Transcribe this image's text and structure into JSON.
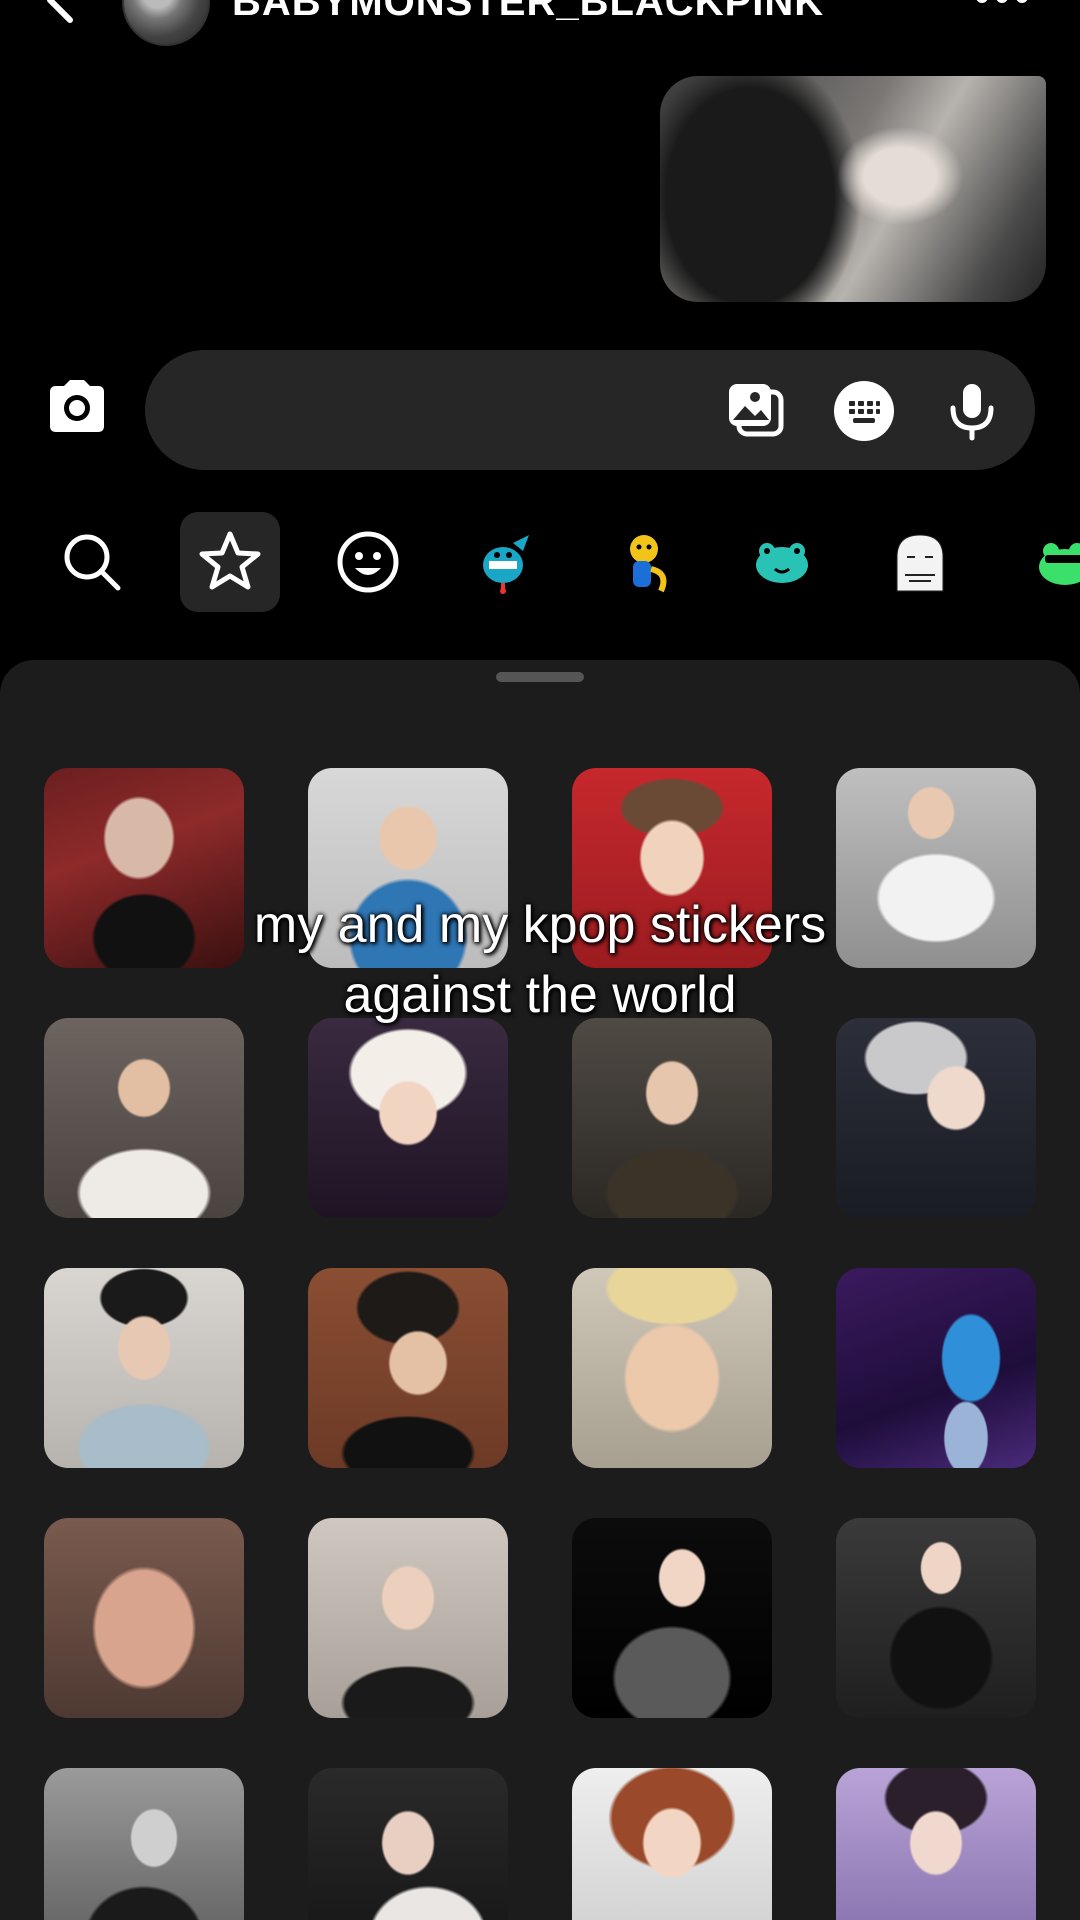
{
  "header": {
    "username": "BABYMONSTER_BLACKPINK"
  },
  "composer": {
    "placeholder": ""
  },
  "tray_tabs": [
    {
      "name": "search-icon"
    },
    {
      "name": "favorites-star-icon",
      "active": true
    },
    {
      "name": "emoji-icon"
    },
    {
      "name": "sticker-pack-blue-monster"
    },
    {
      "name": "sticker-pack-yellow-character"
    },
    {
      "name": "sticker-pack-teal-frog"
    },
    {
      "name": "sticker-pack-white-ghost"
    },
    {
      "name": "sticker-pack-green-frog"
    }
  ],
  "caption": {
    "line1": "my and my kpop stickers",
    "line2": "against the world"
  },
  "stickers": [
    {
      "name": "sticker-red-dress-woman"
    },
    {
      "name": "sticker-blue-hoodie-hands-on-head"
    },
    {
      "name": "sticker-surprised-boy-red-bg"
    },
    {
      "name": "sticker-white-sweater-pose"
    },
    {
      "name": "sticker-boy-eating"
    },
    {
      "name": "sticker-blond-boy-pointing"
    },
    {
      "name": "sticker-smiling-boy-crowd"
    },
    {
      "name": "sticker-silver-hair-waving"
    },
    {
      "name": "sticker-boy-hand-on-neck"
    },
    {
      "name": "sticker-boy-looking-side"
    },
    {
      "name": "sticker-blond-boy-closeup"
    },
    {
      "name": "sticker-blue-hoodie-dancer"
    },
    {
      "name": "sticker-face-closeup-blurry"
    },
    {
      "name": "sticker-girl-hands-on-head"
    },
    {
      "name": "sticker-girl-school-uniform"
    },
    {
      "name": "sticker-girl-black-tee-sofa"
    },
    {
      "name": "sticker-bw-girl-pose"
    },
    {
      "name": "sticker-girl-hand-on-head"
    },
    {
      "name": "sticker-red-hair-surprised"
    },
    {
      "name": "sticker-girl-waving-lilac"
    }
  ],
  "colors": {
    "background": "#000000",
    "sheet": "#1c1c1c",
    "composer": "#262626"
  }
}
